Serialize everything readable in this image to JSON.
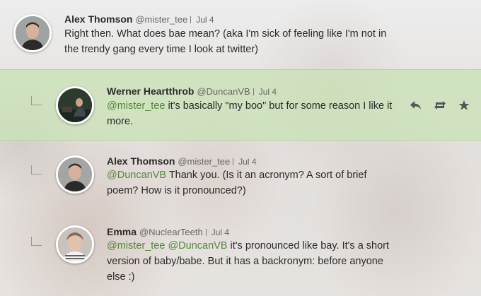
{
  "tweets": [
    {
      "name": "Alex Thomson",
      "handle": "@mister_tee",
      "date": "Jul 4",
      "text_parts": [
        "Right then. What does bae mean? (aka I'm sick of feeling like I'm not in the trendy gang every time I look at twitter)"
      ]
    },
    {
      "name": "Werner Heartthrob",
      "handle": "@DuncanVB",
      "date": "Jul 4",
      "mention1": "@mister_tee",
      "text": " it's basically \"my boo\" but for some reason I like it more."
    },
    {
      "name": "Alex Thomson",
      "handle": "@mister_tee",
      "date": "Jul 4",
      "mention1": "@DuncanVB",
      "text": " Thank you. (Is it an acronym? A sort of brief poem? How is it pronounced?)"
    },
    {
      "name": "Emma",
      "handle": "@NuclearTeeth",
      "date": "Jul 4",
      "mention1": "@mister_tee",
      "mention2": "@DuncanVB",
      "text": " it's pronounced like bay. It's a short version of baby/babe. But it has a backronym: before anyone else :)"
    }
  ],
  "actions": [
    "reply-icon",
    "retweet-icon",
    "favorite-icon"
  ],
  "colors": {
    "mention": "#55873a",
    "highlight": "#c8e1b4"
  }
}
